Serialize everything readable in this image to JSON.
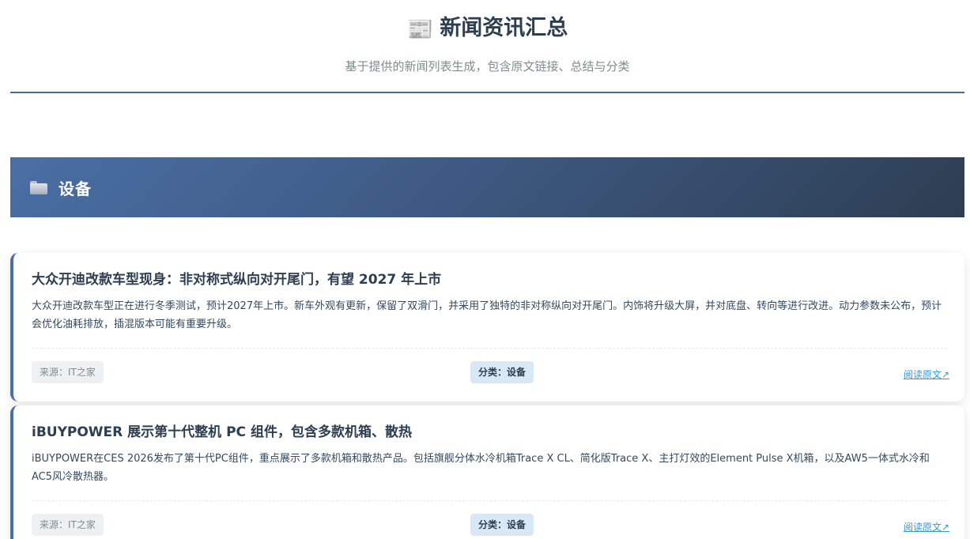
{
  "header": {
    "title_icon": "newspaper-icon",
    "title_emoji": "📰",
    "title": "新闻资讯汇总",
    "subtitle": "基于提供的新闻列表生成，包含原文链接、总结与分类"
  },
  "section": {
    "icon": "folder-icon",
    "title": "设备"
  },
  "articles": [
    {
      "title": "大众开迪改款车型现身：非对称式纵向对开尾门，有望 2027 年上市",
      "summary": "大众开迪改款车型正在进行冬季测试，预计2027年上市。新车外观有更新，保留了双滑门，并采用了独特的非对称纵向对开尾门。内饰将升级大屏，并对底盘、转向等进行改进。动力参数未公布，预计会优化油耗排放，插混版本可能有重要升级。",
      "source": "来源：IT之家",
      "category": "分类：设备",
      "link_text": "阅读原文↗"
    },
    {
      "title": "iBUYPOWER 展示第十代整机 PC 组件，包含多款机箱、散热",
      "summary": "iBUYPOWER在CES 2026发布了第十代PC组件，重点展示了多款机箱和散热产品。包括旗舰分体水冷机箱Trace X CL、简化版Trace X、主打灯效的Element Pulse X机箱，以及AW5一体式水冷和AC5风冷散热器。",
      "source": "来源：IT之家",
      "category": "分类：设备",
      "link_text": "阅读原文↗"
    }
  ],
  "colors": {
    "accent": "#4a6fa5",
    "header_gradient_end": "#2d3e52",
    "link": "#3498db",
    "title_text": "#2c3e50",
    "muted_text": "#7f8c8d"
  }
}
